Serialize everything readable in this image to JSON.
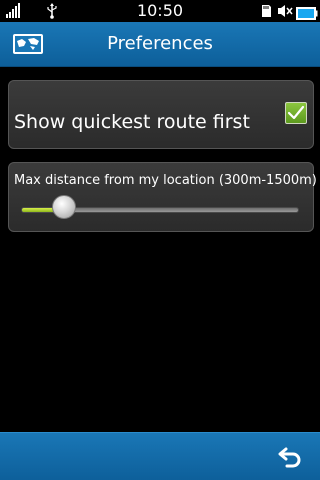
{
  "status_bar": {
    "time": "10:50",
    "icons": [
      "signal-bars-icon",
      "usb-icon",
      "sd-card-icon",
      "mute-icon",
      "battery-icon"
    ]
  },
  "title_bar": {
    "title": "Preferences",
    "app_icon": "map-icon"
  },
  "preferences": {
    "quickest_route": {
      "label": "Show quickest route first",
      "checked": true
    },
    "max_distance": {
      "label": "Max distance from my location (300m-1500m)",
      "min": 300,
      "max": 1500,
      "value_fraction": 0.16
    }
  },
  "bottom_bar": {
    "back_icon": "back-arrow-icon"
  },
  "colors": {
    "accent_blue": "#1a77b6",
    "check_green": "#6fae2a",
    "slider_fill": "#b7d82e",
    "card_bg": "#333333",
    "background": "#000000"
  }
}
